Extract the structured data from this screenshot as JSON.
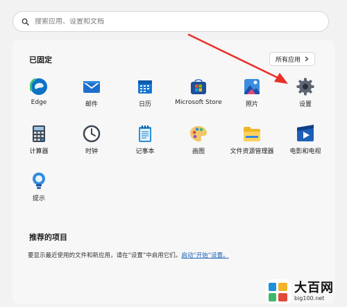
{
  "search": {
    "placeholder": "搜索应用、设置和文档"
  },
  "pinned": {
    "title": "已固定",
    "all_apps_label": "所有应用",
    "apps": [
      {
        "label": "Edge",
        "icon": "edge-icon"
      },
      {
        "label": "邮件",
        "icon": "mail-icon"
      },
      {
        "label": "日历",
        "icon": "calendar-icon"
      },
      {
        "label": "Microsoft Store",
        "icon": "store-icon"
      },
      {
        "label": "照片",
        "icon": "photos-icon"
      },
      {
        "label": "设置",
        "icon": "gear-icon"
      },
      {
        "label": "计算器",
        "icon": "calculator-icon"
      },
      {
        "label": "时钟",
        "icon": "clock-icon"
      },
      {
        "label": "记事本",
        "icon": "notepad-icon"
      },
      {
        "label": "画图",
        "icon": "paint-icon"
      },
      {
        "label": "文件资源管理器",
        "icon": "folder-icon"
      },
      {
        "label": "电影和电视",
        "icon": "movies-icon"
      },
      {
        "label": "提示",
        "icon": "tips-icon"
      }
    ]
  },
  "recommended": {
    "title": "推荐的项目",
    "text_before": "要显示最近使用的文件和新应用，请在“设置”中启用它们。",
    "link_text": "启动“开始”设置。"
  },
  "watermark": {
    "big_text": "大百网",
    "small_text": "big100.net"
  },
  "colors": {
    "arrow": "#e8302a",
    "accent": "#0067c0",
    "link": "#1a5fb4"
  }
}
